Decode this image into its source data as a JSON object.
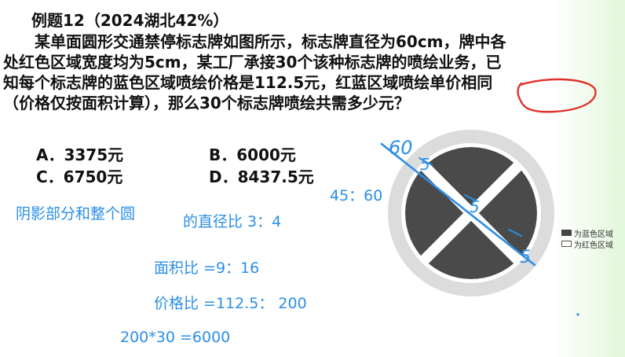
{
  "problem": {
    "title": "例题12（2024湖北42%）",
    "lines": [
      "某单面圆形交通禁停标志牌如图所示，标志牌直径为60cm，牌中各",
      "处红色区域宽度均为5cm，某工厂承接30个该种标志牌的喷绘业务，已",
      "知每个标志牌的蓝色区域喷绘价格是112.5元，红蓝区域喷绘单价相同",
      "（价格仅按面积计算），那么30个标志牌喷绘共需多少元？"
    ]
  },
  "options": {
    "a": "A．3375元",
    "b": "B．6000元",
    "c": "C．6750元",
    "d": "D．8437.5元"
  },
  "legend": {
    "blue": "为蓝色区域",
    "red": "为红色区域"
  },
  "annotations": {
    "ratio_45_60": "45：60",
    "shadow_ratio": "阴影部分和整个圆",
    "diameter_ratio": "的直径比  3：4",
    "area_ratio": "面积比 =9：16",
    "price_ratio": "价格比 =112.5：  200",
    "total": "200*30 =6000",
    "handwritten_60": "60",
    "handwritten_5a": "5",
    "handwritten_5b": "5",
    "handwritten_5c": "5"
  },
  "colors": {
    "ink_blue": "#2b8fe6",
    "ink_red": "#e0322c",
    "sign_dark": "#4a4a4a",
    "sign_ring": "#d9d9d9"
  }
}
